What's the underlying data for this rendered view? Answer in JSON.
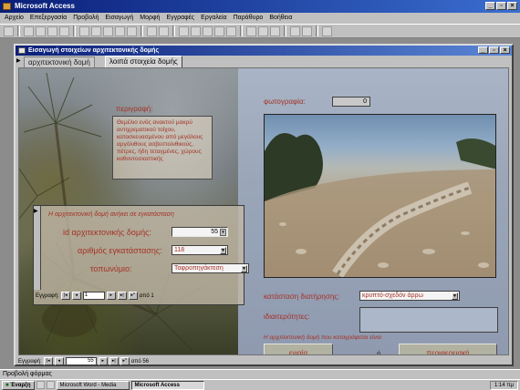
{
  "app": {
    "title": "Microsoft Access"
  },
  "menu": [
    "Αρχείο",
    "Επεξεργασία",
    "Προβολή",
    "Εισαγωγή",
    "Μορφή",
    "Εγγραφές",
    "Εργαλεία",
    "Παράθυρο",
    "Βοήθεια"
  ],
  "form_window": {
    "title": "Εισαγωγή στοιχείων αρχιτεκτονικής δομής",
    "tabs": [
      "αρχιτεκτονική δομή",
      "λοιπά στοιχεία δομής"
    ],
    "active_tab": 1
  },
  "main": {
    "description_label": "περιγραφή:",
    "description_text": "Θεμέλιο ενός ανακτού μακρύ αντιχρεματικού τοίχου, κατασκευασμένου από μεγάλους αργόλιθους ασβεστολιθικούς, πέτρες, ήδη τεταγμένες, χώρους καθοντοσιαστικής",
    "photo_label": "φωτογραφία:",
    "photo_count": "0",
    "condition_label": "κατάσταση διατήρησης:",
    "condition_value": "κρυπτό-σχεδόν άρρω",
    "features_label": "ιδιαιτερότητες:",
    "features_value": "",
    "part_of_text": "Η αρχιτεκτονική δομή που καταγράφεται είναι",
    "unit_button": "ενιαία",
    "separator_char": "ή",
    "peripheral_button": "περιφερειακή"
  },
  "subform": {
    "header": "Η αρχιτεκτονική δομή ανήκει σε εγκατάσταση",
    "id_label": "id αρχιτεκτονικής δομής:",
    "id_value": "55",
    "install_label": "αριθμός εγκατάστασης:",
    "install_value": "118",
    "place_label": "τοπωνύμιο:",
    "place_value": "Ταφροπηγάκτεση",
    "nav_label": "Εγγραφή:",
    "nav_pos": "1",
    "nav_total": "από 1"
  },
  "main_nav": {
    "label": "Εγγραφή:",
    "pos": "55",
    "total": "από 56"
  },
  "status": {
    "text": "Προβολή φόρμας"
  },
  "taskbar": {
    "start": "Έναρξη",
    "tasks": [
      "Microsoft Word - Media",
      "Microsoft Access"
    ],
    "clock": "1:14 πμ"
  },
  "colors": {
    "label_red": "#a43226",
    "title_blue": "#0a1e78"
  }
}
